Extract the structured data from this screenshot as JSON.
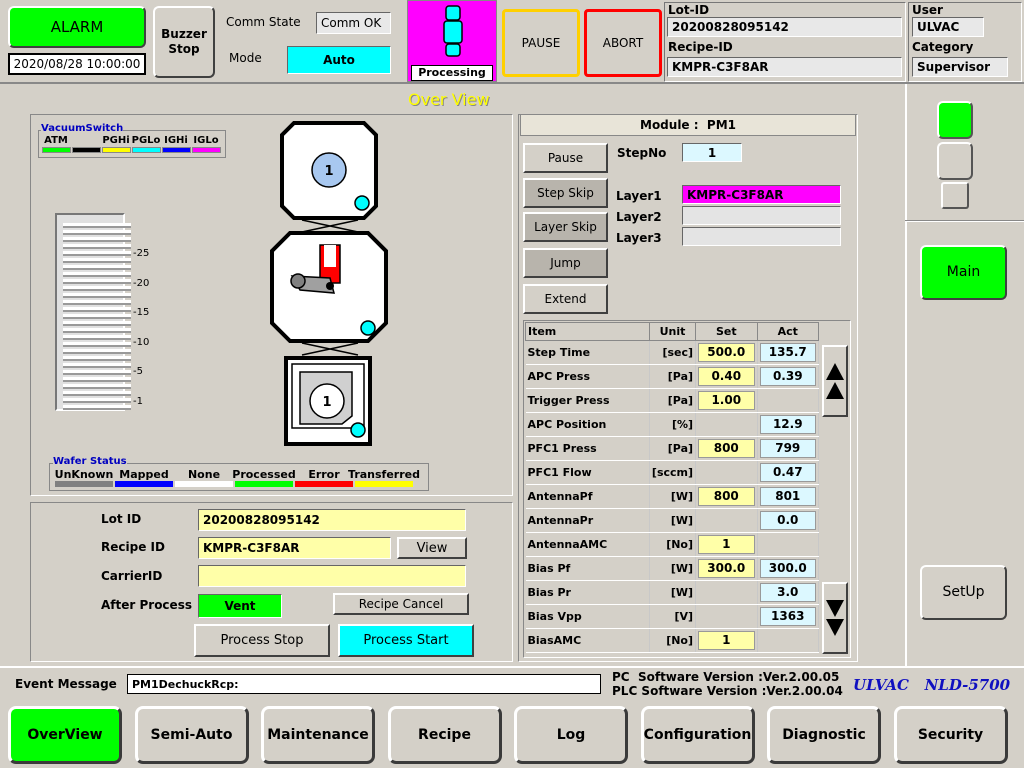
{
  "header": {
    "alarm_label": "ALARM",
    "datetime": "2020/08/28 10:00:00",
    "buzzer_label": "Buzzer Stop",
    "comm_state_label": "Comm State",
    "comm_state_value": "Comm OK",
    "mode_label": "Mode",
    "mode_value": "Auto",
    "status_text": "Processing",
    "pause_label": "PAUSE",
    "abort_label": "ABORT",
    "lot_id_label": "Lot-ID",
    "lot_id_value": "20200828095142",
    "recipe_id_label": "Recipe-ID",
    "recipe_id_value": "KMPR-C3F8AR",
    "user_label": "User",
    "user_value": "ULVAC",
    "category_label": "Category",
    "category_value": "Supervisor"
  },
  "title": "Over View",
  "vacuum": {
    "title": "VacuumSwitch",
    "items": [
      {
        "label": "ATM",
        "color": "#00ff00"
      },
      {
        "label": "",
        "color": "#000000"
      },
      {
        "label": "PGHi",
        "color": "#ffff00"
      },
      {
        "label": "PGLo",
        "color": "#00ffff"
      },
      {
        "label": "IGHi",
        "color": "#0000ff"
      },
      {
        "label": "IGLo",
        "color": "#ff00ff"
      }
    ],
    "scale": [
      "-25",
      "-20",
      "-15",
      "-10",
      "-5",
      "-1"
    ]
  },
  "chambers": {
    "top_wafer": "1",
    "bottom_wafer": "1"
  },
  "wafer_status": {
    "title": "Wafer Status",
    "items": [
      {
        "label": "UnKnown",
        "color": "#808080"
      },
      {
        "label": "Mapped",
        "color": "#0000ff"
      },
      {
        "label": "None",
        "color": "#ffffff"
      },
      {
        "label": "Processed",
        "color": "#00ff00"
      },
      {
        "label": "Error",
        "color": "#ff0000"
      },
      {
        "label": "Transferred",
        "color": "#ffff00"
      }
    ]
  },
  "lot_form": {
    "lot_id_label": "Lot ID",
    "lot_id_value": "20200828095142",
    "recipe_id_label": "Recipe ID",
    "recipe_id_value": "KMPR-C3F8AR",
    "view_label": "View",
    "carrier_label": "CarrierID",
    "carrier_value": "",
    "after_process_label": "After Process",
    "after_process_value": "Vent",
    "recipe_cancel_label": "Recipe Cancel",
    "process_stop_label": "Process Stop",
    "process_start_label": "Process Start"
  },
  "module": {
    "title": "Module :  PM1",
    "pause_label": "Pause",
    "step_skip_label": "Step Skip",
    "layer_skip_label": "Layer Skip",
    "jump_label": "Jump",
    "extend_label": "Extend",
    "step_no_label": "StepNo",
    "step_no_value": "1",
    "layer1_label": "Layer1",
    "layer1_value": "KMPR-C3F8AR",
    "layer2_label": "Layer2",
    "layer2_value": "",
    "layer3_label": "Layer3",
    "layer3_value": ""
  },
  "table": {
    "headers": [
      "Item",
      "Unit",
      "Set",
      "Act"
    ],
    "rows": [
      {
        "item": "Step Time",
        "unit": "[sec]",
        "set": "500.0",
        "act": "135.7"
      },
      {
        "item": "APC Press",
        "unit": "[Pa]",
        "set": "0.40",
        "act": "0.39"
      },
      {
        "item": "Trigger Press",
        "unit": "[Pa]",
        "set": "1.00",
        "act": ""
      },
      {
        "item": "APC Position",
        "unit": "[%]",
        "set": "",
        "act": "12.9"
      },
      {
        "item": "PFC1 Press",
        "unit": "[Pa]",
        "set": "800",
        "act": "799"
      },
      {
        "item": "PFC1 Flow",
        "unit": "[sccm]",
        "set": "",
        "act": "0.47"
      },
      {
        "item": "AntennaPf",
        "unit": "[W]",
        "set": "800",
        "act": "801"
      },
      {
        "item": "AntennaPr",
        "unit": "[W]",
        "set": "",
        "act": "0.0"
      },
      {
        "item": "AntennaAMC",
        "unit": "[No]",
        "set": "1",
        "act": ""
      },
      {
        "item": "Bias Pf",
        "unit": "[W]",
        "set": "300.0",
        "act": "300.0"
      },
      {
        "item": "Bias Pr",
        "unit": "[W]",
        "set": "",
        "act": "3.0"
      },
      {
        "item": "Bias Vpp",
        "unit": "[V]",
        "set": "",
        "act": "1363"
      },
      {
        "item": "BiasAMC",
        "unit": "[No]",
        "set": "1",
        "act": ""
      }
    ]
  },
  "side": {
    "main_label": "Main",
    "setup_label": "SetUp"
  },
  "footer": {
    "event_label": "Event Message",
    "event_value": "PM1DechuckRcp:",
    "pc_version": "PC  Software Version :Ver.2.00.05",
    "plc_version": "PLC Software Version :Ver.2.00.04",
    "brand": "ULVAC   NLD-5700"
  },
  "nav": [
    "OverView",
    "Semi-Auto",
    "Maintenance",
    "Recipe",
    "Log",
    "Configuration",
    "Diagnostic",
    "Security"
  ],
  "colors": {
    "green": "#00ff00",
    "cyan": "#00ffff",
    "yellow_field": "#ffffa8",
    "magenta": "#ff00ff",
    "title_yellow": "#ffff00",
    "brand_blue": "#1010c0"
  }
}
